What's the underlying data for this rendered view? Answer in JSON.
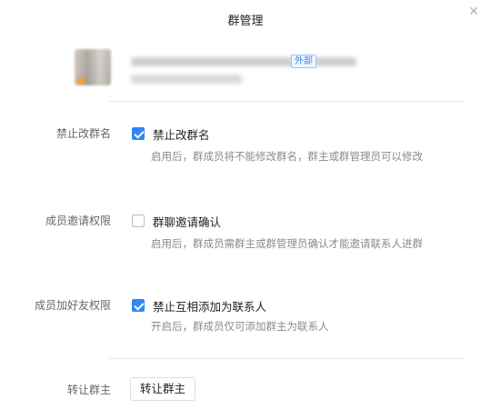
{
  "dialog": {
    "title": "群管理",
    "close_icon": "close-icon"
  },
  "group": {
    "badge": "外部"
  },
  "settings": [
    {
      "label": "禁止改群名",
      "option": "禁止改群名",
      "checked": true,
      "description": "启用后，群成员将不能修改群名，群主或群管理员可以修改"
    },
    {
      "label": "成员邀请权限",
      "option": "群聊邀请确认",
      "checked": false,
      "description": "启用后，群成员需群主或群管理员确认才能邀请联系人进群"
    },
    {
      "label": "成员加好友权限",
      "option": "禁止互相添加为联系人",
      "checked": true,
      "description": "开启后，群成员仅可添加群主为联系人"
    }
  ],
  "transfer": {
    "label": "转让群主",
    "button": "转让群主"
  },
  "colors": {
    "accent": "#2f86f6",
    "badge_text": "#3d86e8"
  }
}
